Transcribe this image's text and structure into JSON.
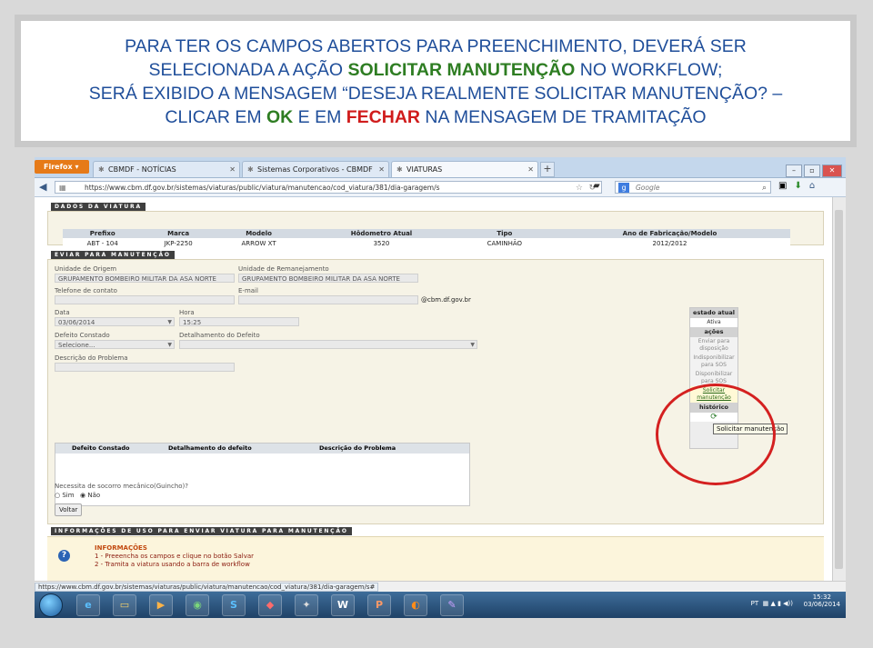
{
  "caption": {
    "line1": "PARA TER OS CAMPOS ABERTOS PARA PREENCHIMENTO, DEVERÁ SER",
    "line2_a": "SELECIONADA  A  AÇÃO ",
    "line2_b": "SOLICITAR MANUTENÇÃO",
    "line2_c": " NO WORKFLOW;",
    "line3": "SERÁ EXIBIDO A MENSAGEM “DESEJA  REALMENTE SOLICITAR MANUTENÇÃO? –",
    "line4_a": "CLICAR EM ",
    "line4_b": "OK",
    "line4_c": " E  EM ",
    "line4_d": "FECHAR",
    "line4_e": " NA MENSAGEM DE TRAMITAÇÃO"
  },
  "browser": {
    "firefox_label": "Firefox",
    "tabs": [
      "CBMDF - NOTÍCIAS",
      "Sistemas Corporativos - CBMDF",
      "VIATURAS"
    ],
    "new_tab": "+",
    "url": "https://www.cbm.df.gov.br/sistemas/viaturas/public/viatura/manutencao/cod_viatura/381/dia-garagem/s",
    "search_placeholder": "Google",
    "status_url": "https://www.cbm.df.gov.br/sistemas/viaturas/public/viatura/manutencao/cod_viatura/381/dia-garagem/s#"
  },
  "dados": {
    "section_title": "DADOS DA VIATURA",
    "headers": [
      "Prefixo",
      "Marca",
      "Modelo",
      "Hôdometro Atual",
      "Tipo",
      "Ano de Fabricação/Modelo"
    ],
    "row": [
      "ABT - 104",
      "JKP-2250",
      "ARROW XT",
      "3520",
      "CAMINHÃO",
      "2012/2012"
    ]
  },
  "form": {
    "section_title": "EVIAR PARA MANUTENÇÃO",
    "origem_label": "Unidade de Origem",
    "origem_value": "GRUPAMENTO BOMBEIRO MILITAR DA ASA NORTE",
    "remanej_label": "Unidade de Remanejamento",
    "remanej_value": "GRUPAMENTO BOMBEIRO MILITAR DA ASA NORTE",
    "telefone_label": "Telefone de contato",
    "email_label": "E-mail",
    "email_suffix": "@cbm.df.gov.br",
    "data_label": "Data",
    "data_value": "03/06/2014",
    "hora_label": "Hora",
    "hora_value": "15:25",
    "defeito_label": "Defeito Constado",
    "defeito_value": "Selecione...",
    "detalhamento_label": "Detalhamento do Defeito",
    "descricao_label": "Descrição do Problema",
    "grid_headers": [
      "Defeito Constado",
      "Detalhamento do defeito",
      "Descrição do Problema"
    ],
    "guincho_label": "Necessita de socorro mecânico(Guincho)?",
    "sim": "Sim",
    "nao": "Não",
    "voltar": "Voltar"
  },
  "workflow": {
    "estado_atual_label": "estado atual",
    "estado_atual_value": "Ativa",
    "acoes_label": "ações",
    "actions": [
      "Enviar para disposição",
      "Indisponibilizar para SOS",
      "Disponibilizar para SOS",
      "Solicitar manutenção"
    ],
    "historico_label": "histórico",
    "tooltip": "Solicitar manutenção"
  },
  "info": {
    "section_title": "INFORMAÇÕES DE USO PARA ENVIAR VIATURA PARA MANUTENÇÃO",
    "heading": "INFORMAÇÕES",
    "step1": "1 - Preeencha os campos e clique no botão Salvar",
    "step2": "2 - Tramita a viatura usando a barra de workflow"
  },
  "taskbar": {
    "lang": "PT",
    "time": "15:32",
    "date": "03/06/2014"
  },
  "colors": {
    "caption_blue": "#1f4e9a",
    "caption_green": "#2e7d22",
    "caption_red": "#d01c1c",
    "highlight_circle": "#d42020"
  }
}
